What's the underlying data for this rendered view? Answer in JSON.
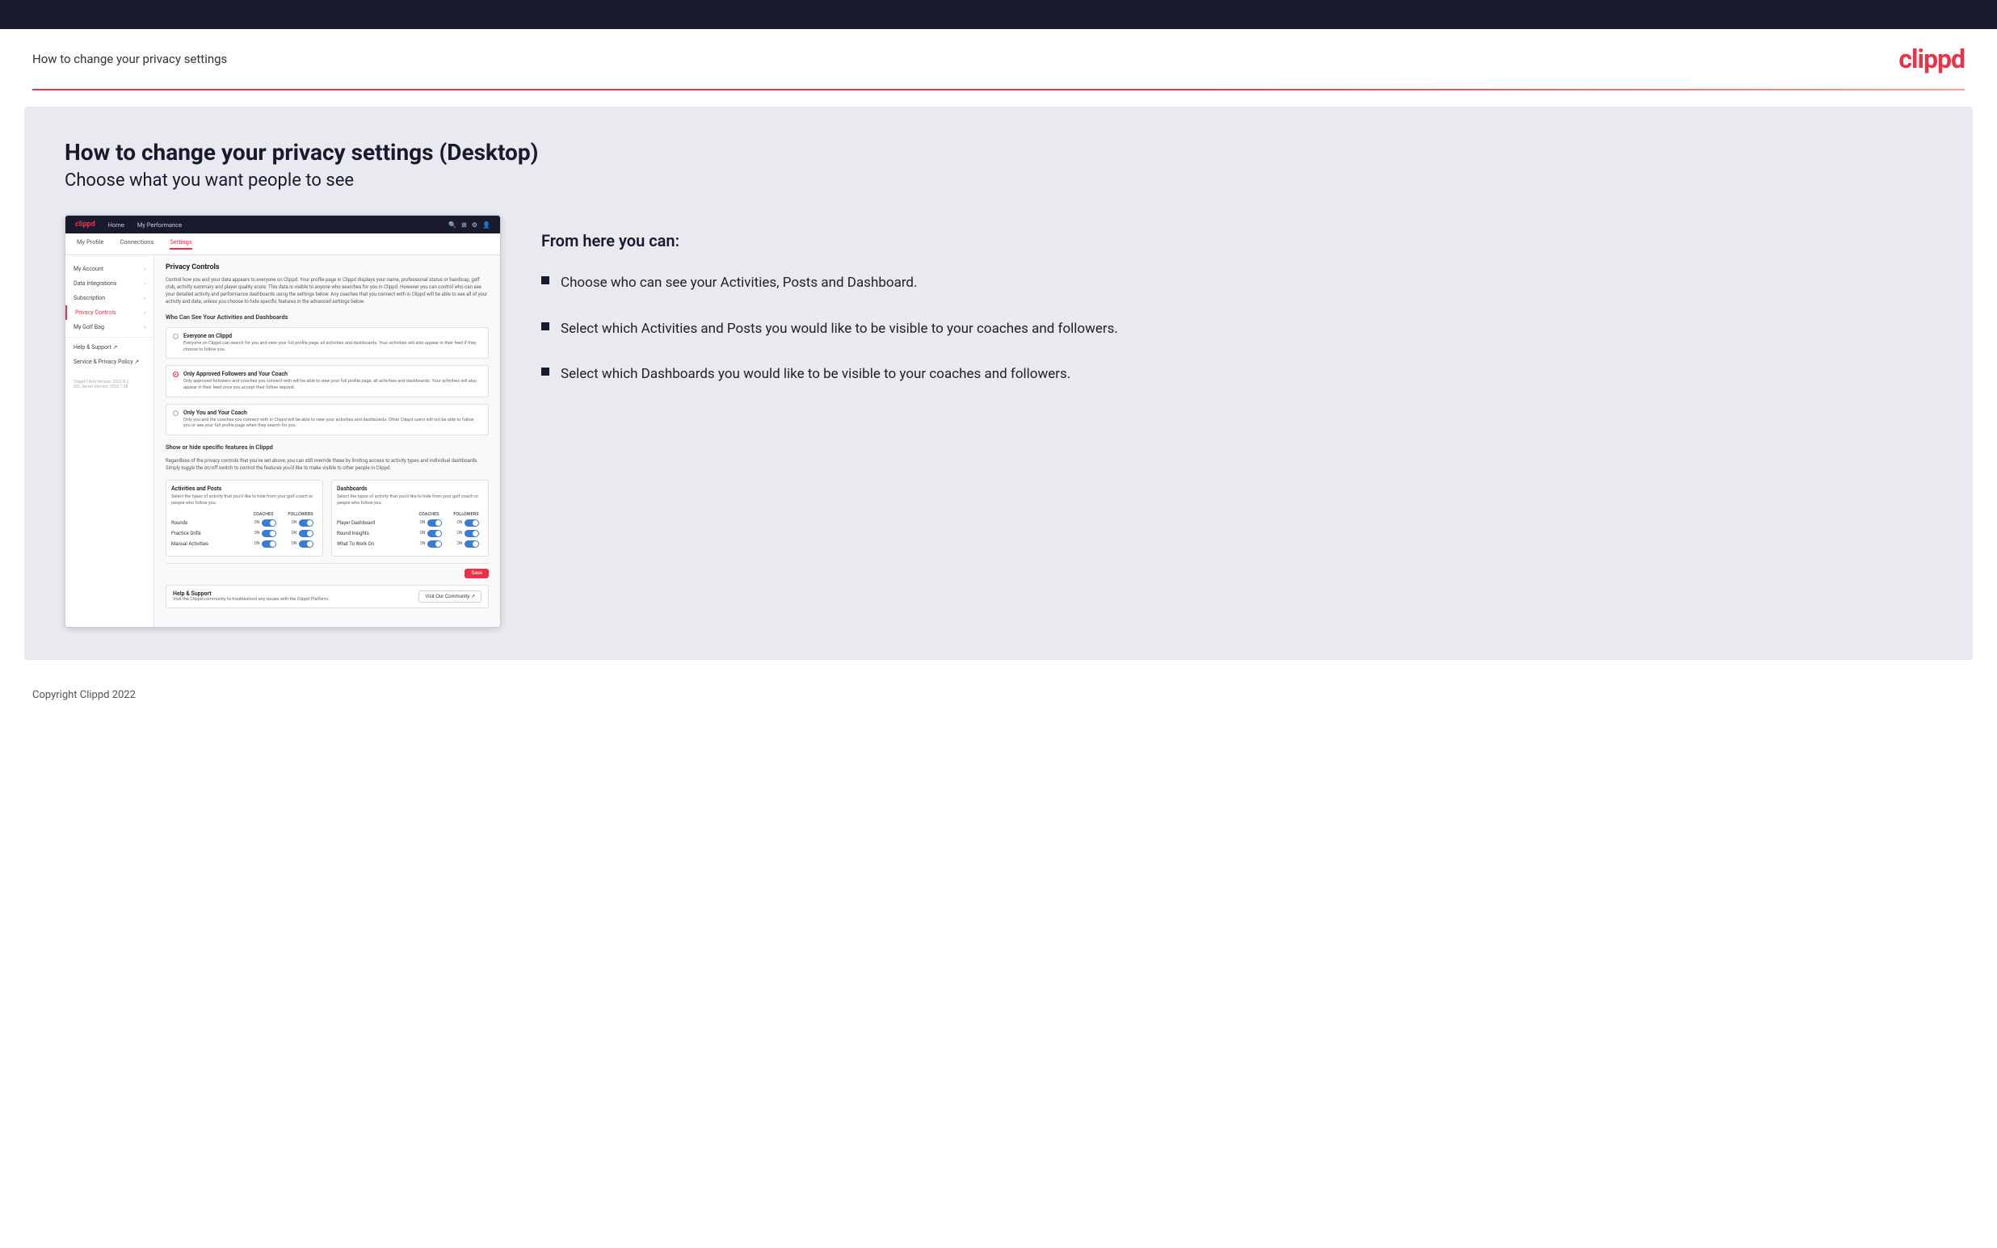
{
  "header": {
    "title": "How to change your privacy settings",
    "logo": "clippd"
  },
  "main": {
    "heading": "How to change your privacy settings (Desktop)",
    "subheading": "Choose what you want people to see",
    "from_here_title": "From here you can:",
    "bullets": [
      "Choose who can see your Activities, Posts and Dashboard.",
      "Select which Activities and Posts you would like to be visible to your coaches and followers.",
      "Select which Dashboards you would like to be visible to your coaches and followers."
    ]
  },
  "app_screenshot": {
    "navbar": {
      "logo": "clippd",
      "items": [
        "Home",
        "My Performance"
      ],
      "icons": [
        "🔍",
        "⚙",
        "👤"
      ]
    },
    "subnav": {
      "items": [
        "My Profile",
        "Connections",
        "Settings"
      ]
    },
    "sidebar": {
      "items": [
        {
          "label": "My Account",
          "active": false
        },
        {
          "label": "Data Integrations",
          "active": false
        },
        {
          "label": "Subscription",
          "active": false
        },
        {
          "label": "Privacy Controls",
          "active": true
        },
        {
          "label": "My Golf Bag",
          "active": false
        },
        {
          "label": "Help & Support",
          "active": false
        },
        {
          "label": "Service & Privacy Policy",
          "active": false
        }
      ],
      "version": "Clippd Client Version: 2022.8.2\nSQL Server Version: 2022.7.38"
    },
    "panel": {
      "title": "Privacy Controls",
      "description": "Control how you and your data appears to everyone on Clippd. Your profile page in Clippd displays your name, professional status or handicap, golf club, activity summary and player quality score. This data is visible to anyone who searches for you in Clippd. However you can control who can see your detailed activity and performance dashboards using the settings below. Any coaches that you connect with in Clippd will be able to see all of your activity and data, unless you choose to hide specific features in the advanced settings below.",
      "who_can_see_heading": "Who Can See Your Activities and Dashboards",
      "radio_options": [
        {
          "id": "everyone",
          "label": "Everyone on Clippd",
          "description": "Everyone on Clippd can search for you and view your full profile page, all activities and dashboards. Your activities will also appear in their feed if they choose to follow you.",
          "selected": false
        },
        {
          "id": "followers_coach",
          "label": "Only Approved Followers and Your Coach",
          "description": "Only approved followers and coaches you connect with will be able to view your full profile page, all activities and dashboards. Your activities will also appear in their feed once you accept their follow request.",
          "selected": true
        },
        {
          "id": "you_coach",
          "label": "Only You and Your Coach",
          "description": "Only you and the coaches you connect with in Clippd will be able to view your activities and dashboards. Other Clippd users will not be able to follow you or see your full profile page when they search for you.",
          "selected": false
        }
      ],
      "show_hide_heading": "Show or hide specific features in Clippd",
      "show_hide_desc": "Regardless of the privacy controls that you've set above, you can still override these by limiting access to activity types and individual dashboards. Simply toggle the on/off switch to control the features you'd like to make visible to other people in Clippd.",
      "activities_posts": {
        "title": "Activities and Posts",
        "desc": "Select the types of activity that you'd like to hide from your golf coach or people who follow you.",
        "coaches_label": "COACHES",
        "followers_label": "FOLLOWERS",
        "rows": [
          {
            "label": "Rounds",
            "coaches": "ON",
            "followers": "ON"
          },
          {
            "label": "Practice Drills",
            "coaches": "ON",
            "followers": "ON"
          },
          {
            "label": "Manual Activities",
            "coaches": "ON",
            "followers": "ON"
          }
        ]
      },
      "dashboards": {
        "title": "Dashboards",
        "desc": "Select the types of activity that you'd like to hide from your golf coach or people who follow you.",
        "coaches_label": "COACHES",
        "followers_label": "FOLLOWERS",
        "rows": [
          {
            "label": "Player Dashboard",
            "coaches": "ON",
            "followers": "ON"
          },
          {
            "label": "Round Insights",
            "coaches": "ON",
            "followers": "ON"
          },
          {
            "label": "What To Work On",
            "coaches": "ON",
            "followers": "ON"
          }
        ]
      },
      "save_label": "Save",
      "help": {
        "title": "Help & Support",
        "desc": "Visit the Clippd community to troubleshoot any issues with the Clippd Platform.",
        "button_label": "Visit Our Community"
      }
    }
  },
  "footer": {
    "copyright": "Copyright Clippd 2022"
  }
}
